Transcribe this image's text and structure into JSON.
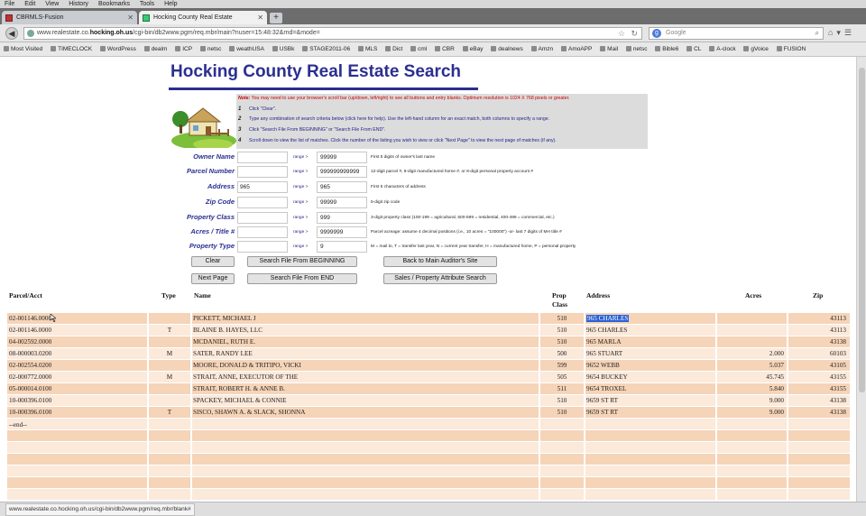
{
  "browser": {
    "menu": [
      "File",
      "Edit",
      "View",
      "History",
      "Bookmarks",
      "Tools",
      "Help"
    ],
    "tabs": [
      {
        "label": "CBRMLS-Fusion"
      },
      {
        "label": "Hocking County Real Estate"
      }
    ],
    "new_tab_label": "+",
    "url_prefix": "www.realestate.co.",
    "url_domain": "hocking.oh.us",
    "url_rest": "/cgi-bin/db2www.pgm/req.mbr/main?nuser=15:48:32&rnd=&mode=",
    "search_placeholder": "Google",
    "bookmarks": [
      "Most Visited",
      "TIMECLOCK",
      "WordPress",
      "dealm",
      "ICP",
      "netsc",
      "weathUSA",
      "USBk",
      "STAGE2011-06",
      "MLS",
      "Dict",
      "cml",
      "CBR",
      "eBay",
      "dealnews",
      "Amzn",
      "AmoAPP",
      "Mail",
      "netsc",
      "Bible6",
      "CL",
      "A-clock",
      "gVoice",
      "FUSION"
    ],
    "status_url": "www.realestate.co.hocking.oh.us/cgi-bin/db2www.pgm/req.mbr/blank#"
  },
  "page": {
    "title": "Hocking County Real Estate Search",
    "note_label": "Note:",
    "note_text": "You may need to use your browser's scroll bar (up/down, left/right) to see all buttons and entry blanks. Optimum resolution is 1024 X 768 pixels or greater.",
    "steps": [
      {
        "n": "1",
        "text": "Click \"Clear\"."
      },
      {
        "n": "2",
        "text": "Type any combination of search criteria below (click here for help). Use the left-hand column for an exact match, both columns to specify a range."
      },
      {
        "n": "3",
        "text": "Click \"Search File From BEGINNING\" or \"Search File From END\"."
      },
      {
        "n": "4",
        "text": "Scroll down to view the list of matches. Click the number of the listing you wish to view or click \"Next Page\" to view the next page of matches (if any)."
      }
    ],
    "fields": [
      {
        "label": "Owner Name",
        "value": "",
        "range": "range >",
        "range_value": "99999",
        "hint": "First 5 digits of owner's last name"
      },
      {
        "label": "Parcel Number",
        "value": "",
        "range": "range >",
        "range_value": "999999999999",
        "hint": "12-digit parcel #, 8-digit manufactured home #, or 8-digit personal property account #"
      },
      {
        "label": "Address",
        "value": "965",
        "range": "range >",
        "range_value": "965",
        "hint": "First 5 characters of address"
      },
      {
        "label": "Zip Code",
        "value": "",
        "range": "range >",
        "range_value": "99999",
        "hint": "5-digit zip code"
      },
      {
        "label": "Property Class",
        "value": "",
        "range": "range >",
        "range_value": "999",
        "hint": "3-digit property class (100-199 = agricultural, 500-599 = residential, 400-499 = commercial, etc.)"
      },
      {
        "label": "Acres / Title #",
        "value": "",
        "range": "range >",
        "range_value": "9999999",
        "hint": "Parcel acreage: assume 4 decimal positions (i.e., 10 acres = \"100000\") -or- last 7 digits of MH title #"
      },
      {
        "label": "Property Type",
        "value": "",
        "range": "range >",
        "range_value": "9",
        "hint": "M = mail to, T = transfer last year, N = current year transfer, H = manufactured home, P = personal property"
      }
    ],
    "buttons": {
      "clear": "Clear",
      "search_begin": "Search File From BEGINNING",
      "main_site": "Back to Main Auditor's Site",
      "next_page": "Next Page",
      "search_end": "Search File From END",
      "sales": "Sales / Property Attribute Search"
    },
    "table": {
      "headers": {
        "parcel": "Parcel/Acct",
        "type": "Type",
        "name": "Name",
        "prop_class": "Prop Class",
        "address": "Address",
        "acres": "Acres",
        "zip": "Zip"
      },
      "rows": [
        {
          "parcel": "02-001146.0000",
          "type": "",
          "name": "PICKETT, MICHAEL J",
          "cls": "510",
          "address": "965 CHARLES",
          "acres": "",
          "zip": "43113"
        },
        {
          "parcel": "02-001146.0000",
          "type": "T",
          "name": "BLAINE B. HAYES, LLC",
          "cls": "510",
          "address": "965 CHARLES",
          "acres": "",
          "zip": "43113"
        },
        {
          "parcel": "04-002592.0000",
          "type": "",
          "name": "MCDANIEL, RUTH E.",
          "cls": "510",
          "address": "965 MARLA",
          "acres": "",
          "zip": "43138"
        },
        {
          "parcel": "08-000003.0200",
          "type": "M",
          "name": "SATER, RANDY LEE",
          "cls": "500",
          "address": "965 STUART",
          "acres": "2.000",
          "zip": "60103"
        },
        {
          "parcel": "02-002554.0200",
          "type": "",
          "name": "MOORE, DONALD & TRITIPO, VICKI",
          "cls": "599",
          "address": "9652 WEBB",
          "acres": "5.037",
          "zip": "43105"
        },
        {
          "parcel": "02-000772.0000",
          "type": "M",
          "name": "STRAIT, ANNE, EXECUTOR OF THE",
          "cls": "505",
          "address": "9654 BUCKEY",
          "acres": "45.745",
          "zip": "43155"
        },
        {
          "parcel": "05-000014.0100",
          "type": "",
          "name": "STRAIT, ROBERT H. & ANNE B.",
          "cls": "511",
          "address": "9654 TROXEL",
          "acres": "5.840",
          "zip": "43155"
        },
        {
          "parcel": "10-000396.0100",
          "type": "",
          "name": "SPACKEY, MICHAEL & CONNIE",
          "cls": "510",
          "address": "9659 ST RT",
          "acres": "9.000",
          "zip": "43138"
        },
        {
          "parcel": "10-000396.0100",
          "type": "T",
          "name": "SISCO, SHAWN A. & SLACK, SHONNA",
          "cls": "510",
          "address": "9659 ST RT",
          "acres": "9.000",
          "zip": "43138"
        }
      ],
      "end_marker": "--end--"
    }
  }
}
